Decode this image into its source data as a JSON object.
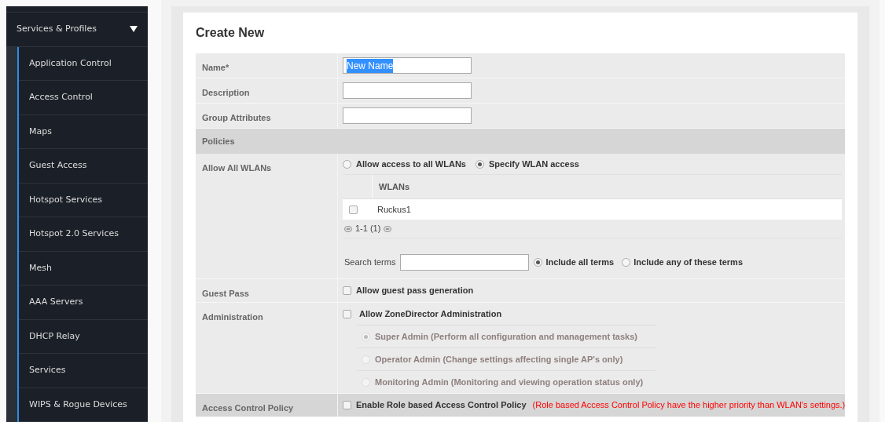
{
  "sidebar": {
    "section": {
      "label": "Services & Profiles",
      "expanded": true
    },
    "items": [
      {
        "label": "Application Control"
      },
      {
        "label": "Access Control"
      },
      {
        "label": "Maps"
      },
      {
        "label": "Guest Access"
      },
      {
        "label": "Hotspot Services"
      },
      {
        "label": "Hotspot 2.0 Services"
      },
      {
        "label": "Mesh"
      },
      {
        "label": "AAA Servers"
      },
      {
        "label": "DHCP Relay"
      },
      {
        "label": "Services"
      },
      {
        "label": "WIPS & Rogue Devices"
      }
    ]
  },
  "form": {
    "title": "Create New",
    "rows": [
      {
        "kind": "input",
        "label": "Name*",
        "value": "New Name",
        "highlighted": true
      },
      {
        "kind": "input",
        "label": "Description"
      },
      {
        "kind": "input",
        "label": "Group Attributes"
      },
      {
        "kind": "section",
        "label": "Policies"
      },
      {
        "kind": "wlan",
        "label": "Allow All WLANs",
        "options": [
          {
            "label": "Allow access to all WLANs",
            "selected": false
          },
          {
            "label": "Specify WLAN access",
            "selected": true
          }
        ],
        "table": {
          "columns": [
            "WLANs"
          ],
          "rows": [
            {
              "name": "Ruckus1",
              "checked": false
            }
          ]
        },
        "pager": "1-1 (1)",
        "search": {
          "label": "Search terms",
          "options": [
            {
              "label": "Include all terms",
              "selected": true
            },
            {
              "label": "Include any of these terms",
              "selected": false
            }
          ]
        }
      },
      {
        "kind": "checkbox",
        "label": "Guest Pass",
        "checkbox": {
          "label": "Allow guest pass generation",
          "checked": false
        }
      },
      {
        "kind": "admin",
        "label": "Administration",
        "checkbox": {
          "label": "Allow ZoneDirector Administration",
          "checked": false
        },
        "roles": [
          {
            "label": "Super Admin (Perform all configuration and management tasks)",
            "selected": true,
            "disabled": true
          },
          {
            "label": "Operator Admin (Change settings affecting single AP's only)",
            "selected": false,
            "disabled": true
          },
          {
            "label": "Monitoring Admin (Monitoring and viewing operation status only)",
            "selected": false,
            "disabled": true
          }
        ]
      },
      {
        "kind": "checkbox",
        "label": "Access Control Policy",
        "shaded": true,
        "checkbox": {
          "label": "Enable Role based Access Control Policy",
          "checked": false,
          "note": "(Role based Access Control Policy have the higher priority than WLAN's settings.)"
        }
      }
    ]
  }
}
